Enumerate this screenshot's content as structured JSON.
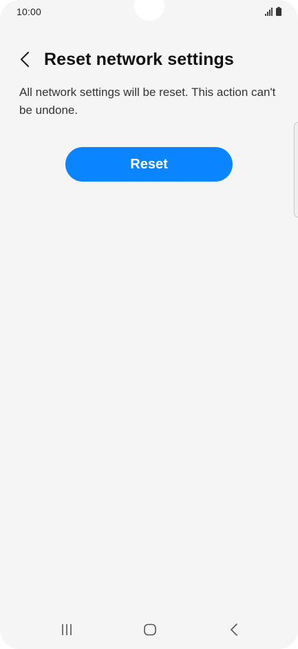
{
  "status_bar": {
    "time": "10:00",
    "icons": [
      "signal-icon",
      "battery-icon"
    ]
  },
  "header": {
    "back_icon": "chevron-left-icon",
    "title": "Reset network settings"
  },
  "description": "All network settings will be reset. This action can't be undone.",
  "reset_button": {
    "label": "Reset"
  },
  "nav_bar": {
    "icons": [
      "recents-icon",
      "home-icon",
      "back-icon"
    ]
  },
  "colors": {
    "background": "#f5f5f6",
    "accent": "#0a84ff",
    "text_primary": "#111111",
    "text_secondary": "#333333"
  }
}
